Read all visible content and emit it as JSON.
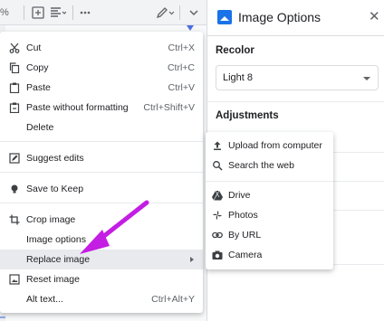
{
  "toolbar": {
    "zoom_fragment": "%",
    "items": [
      "image-icon",
      "align-icon",
      "more-icon",
      "pen-icon",
      "chevron-up-icon"
    ]
  },
  "panel": {
    "title": "Image Options",
    "close_glyph": "✕",
    "recolor_label": "Recolor",
    "recolor_value": "Light 8",
    "adjustments_label": "Adjustments"
  },
  "context_menu": {
    "items": [
      {
        "label": "Cut",
        "shortcut": "Ctrl+X",
        "icon": "scissors-icon"
      },
      {
        "label": "Copy",
        "shortcut": "Ctrl+C",
        "icon": "copy-icon"
      },
      {
        "label": "Paste",
        "shortcut": "Ctrl+V",
        "icon": "paste-icon"
      },
      {
        "label": "Paste without formatting",
        "shortcut": "Ctrl+Shift+V",
        "icon": "paste-plain-icon"
      },
      {
        "label": "Delete",
        "shortcut": "",
        "icon": ""
      },
      {
        "label": "Suggest edits",
        "shortcut": "",
        "icon": "suggest-edits-icon"
      },
      {
        "label": "Save to Keep",
        "shortcut": "",
        "icon": "keep-bulb-icon"
      },
      {
        "label": "Crop image",
        "shortcut": "",
        "icon": "crop-icon"
      },
      {
        "label": "Image options",
        "shortcut": "",
        "icon": ""
      },
      {
        "label": "Replace image",
        "shortcut": "",
        "icon": "",
        "highlighted": true
      },
      {
        "label": "Reset image",
        "shortcut": "",
        "icon": "reset-image-icon"
      },
      {
        "label": "Alt text...",
        "shortcut": "Ctrl+Alt+Y",
        "icon": ""
      }
    ]
  },
  "submenu": {
    "items": [
      {
        "label": "Upload from computer",
        "icon": "upload-icon"
      },
      {
        "label": "Search the web",
        "icon": "search-icon"
      },
      {
        "label": "Drive",
        "icon": "drive-icon"
      },
      {
        "label": "Photos",
        "icon": "photos-pinwheel-icon"
      },
      {
        "label": "By URL",
        "icon": "link-icon"
      },
      {
        "label": "Camera",
        "icon": "camera-icon"
      }
    ]
  },
  "colors": {
    "accent": "#1a73e8",
    "annotation_arrow": "#c41de3",
    "highlight": "#e8eaed"
  }
}
